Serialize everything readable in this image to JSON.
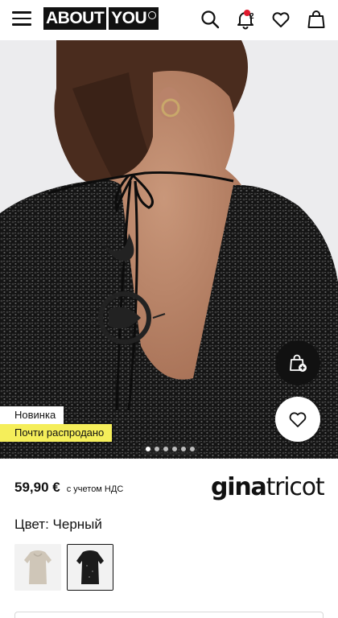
{
  "header": {
    "logo_word1": "ABOUT",
    "logo_word2": "YOU",
    "notification_count": "2",
    "icons": [
      "menu-icon",
      "search-icon",
      "bell-icon",
      "heart-icon",
      "bag-icon"
    ]
  },
  "product": {
    "badges": {
      "new": "Новинка",
      "sold_out_soon": "Почти распродано"
    },
    "gallery": {
      "total_images": 6,
      "active_index": 0
    },
    "price": "59,90 €",
    "vat_note": "с учетом НДС",
    "brand_part1": "gina",
    "brand_part2": "tricot",
    "color_label": "Цвет: Черный",
    "swatches": [
      {
        "name": "beige",
        "selected": false
      },
      {
        "name": "black",
        "selected": true
      }
    ]
  },
  "colors": {
    "accent_red": "#e0192d",
    "badge_yellow": "#f5ee5a",
    "text": "#111111"
  }
}
